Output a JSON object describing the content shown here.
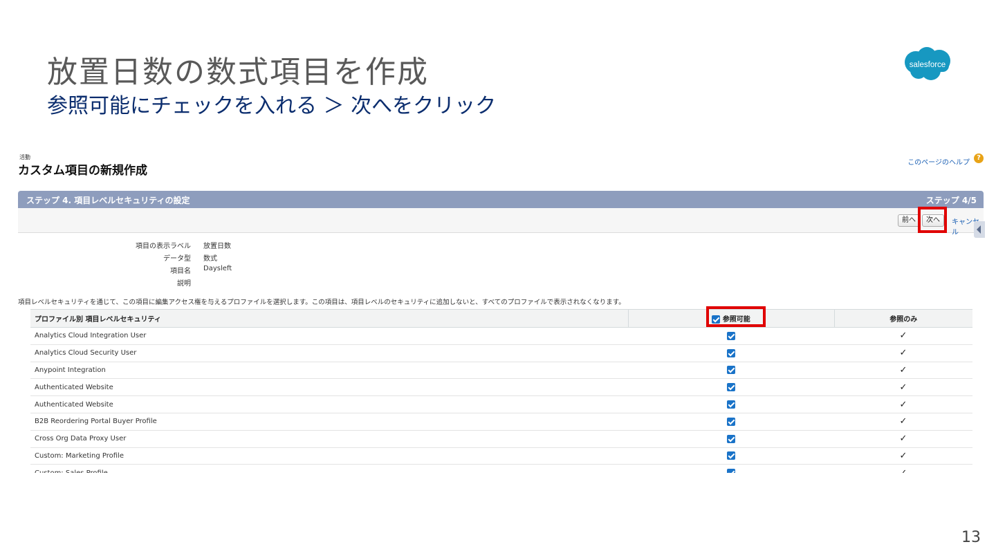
{
  "slide": {
    "title": "放置日数の数式項目を作成",
    "subtitle": "参照可能にチェックを入れる ＞ 次へをクリック",
    "logo_text": "salesforce",
    "page_number": "13",
    "logo_color": "#1798c1",
    "highlight_color": "#e00000"
  },
  "screen": {
    "object_label": "活動",
    "page_title": "カスタム項目の新規作成",
    "help_link": "このページのヘルプ",
    "help_icon": "question-icon",
    "step_title": "ステップ 4. 項目レベルセキュリティの設定",
    "step_count": "ステップ 4/5",
    "buttons": {
      "prev": "前へ",
      "next": "次へ",
      "cancel": "キャンセル"
    },
    "details": [
      {
        "label": "項目の表示ラベル",
        "value": "放置日数"
      },
      {
        "label": "データ型",
        "value": "数式"
      },
      {
        "label": "項目名",
        "value": "Daysleft"
      },
      {
        "label": "説明",
        "value": ""
      }
    ],
    "description": "項目レベルセキュリティを通じて、この項目に編集アクセス権を与えるプロファイルを選択します。この項目は、項目レベルのセキュリティに追加しないと、すべてのプロファイルで表示されなくなります。",
    "table": {
      "headers": {
        "profile": "プロファイル別 項目レベルセキュリティ",
        "visible": "参照可能",
        "readonly": "参照のみ"
      },
      "rows": [
        {
          "profile": "Analytics Cloud Integration User",
          "visible": true,
          "readonly": true
        },
        {
          "profile": "Analytics Cloud Security User",
          "visible": true,
          "readonly": true
        },
        {
          "profile": "Anypoint Integration",
          "visible": true,
          "readonly": true
        },
        {
          "profile": "Authenticated Website",
          "visible": true,
          "readonly": true
        },
        {
          "profile": "Authenticated Website",
          "visible": true,
          "readonly": true
        },
        {
          "profile": "B2B Reordering Portal Buyer Profile",
          "visible": true,
          "readonly": true
        },
        {
          "profile": "Cross Org Data Proxy User",
          "visible": true,
          "readonly": true
        },
        {
          "profile": "Custom: Marketing Profile",
          "visible": true,
          "readonly": true
        },
        {
          "profile": "Custom: Sales Profile",
          "visible": true,
          "readonly": true
        }
      ]
    }
  }
}
